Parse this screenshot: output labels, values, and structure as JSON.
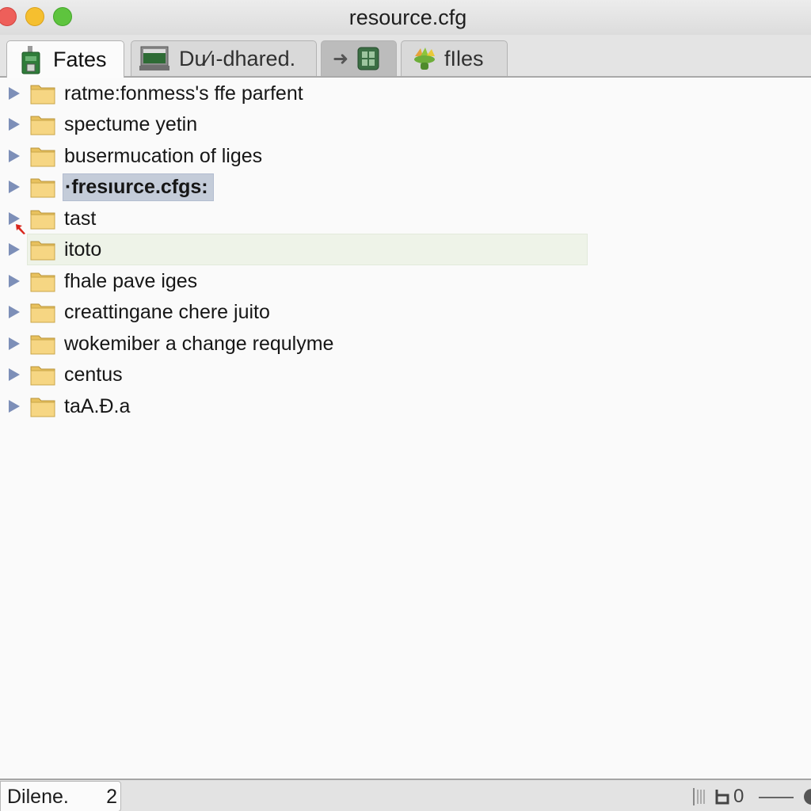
{
  "window": {
    "title": "resource.cfg",
    "controls": [
      "close",
      "minimize",
      "maximize"
    ]
  },
  "tabs": [
    {
      "label": "Fates",
      "icon": "green-drive-icon",
      "active": true
    },
    {
      "label": "Du∕ı-dhared.",
      "icon": "monitor-icon",
      "active": false
    },
    {
      "label": "",
      "icon": "arrow-grid-icon",
      "active": false,
      "pressed": true
    },
    {
      "label": "fIles",
      "icon": "colorful-bag-icon",
      "active": false
    }
  ],
  "tree": {
    "items": [
      {
        "label": "ratme:fonmess's ffe parfent",
        "state": "normal"
      },
      {
        "label": "spectume yetin",
        "state": "normal"
      },
      {
        "label": "busermucation of liges",
        "state": "normal"
      },
      {
        "label": "·fresıurce.cfgs:",
        "state": "selected"
      },
      {
        "label": "tast",
        "state": "normal"
      },
      {
        "label": "itoto",
        "state": "hover"
      },
      {
        "label": "fhale pave iges",
        "state": "normal"
      },
      {
        "label": "creattingane chere juito",
        "state": "normal"
      },
      {
        "label": "wokemiber a change requlyme",
        "state": "normal"
      },
      {
        "label": "centus",
        "state": "normal"
      },
      {
        "label": "taA.Ɖ.a",
        "state": "normal"
      }
    ]
  },
  "statusbar": {
    "name": "Dilene.",
    "count": "2",
    "right_value": "0"
  },
  "colors": {
    "selection": "#c4ccd9",
    "hover": "#eef3e8",
    "disclosure": "#7d8fb8",
    "folder": "#f5d27a"
  }
}
